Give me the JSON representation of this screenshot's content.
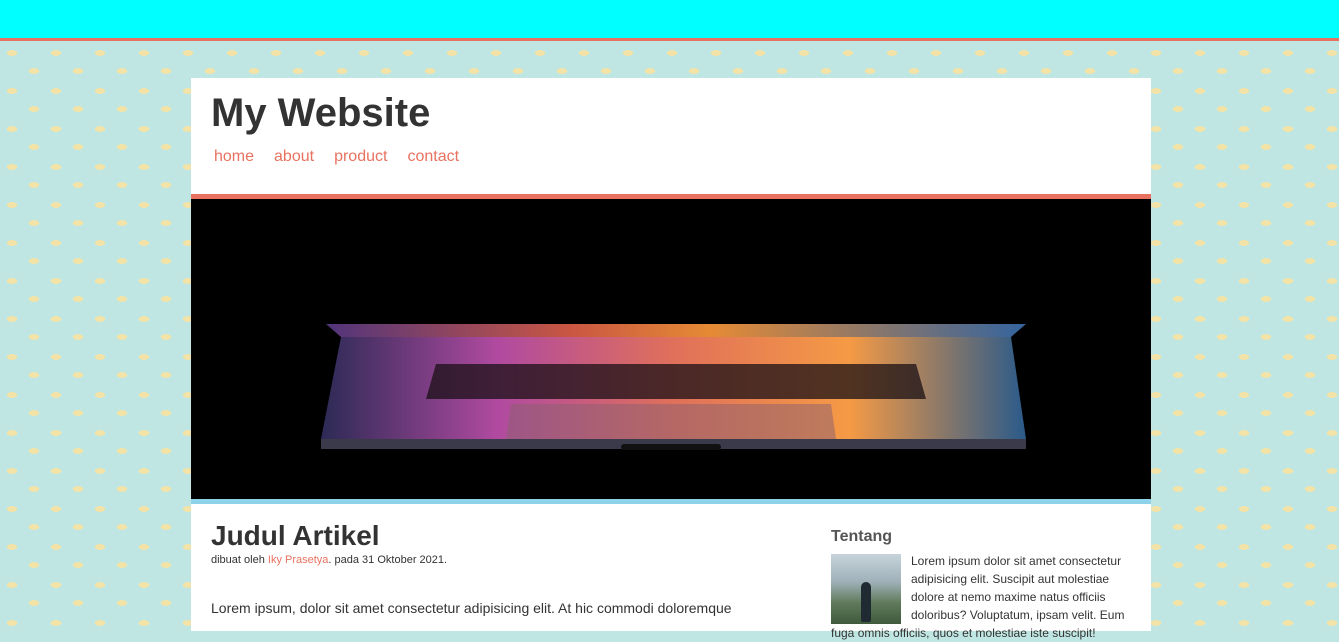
{
  "site": {
    "title": "My Website"
  },
  "nav": [
    {
      "label": "home"
    },
    {
      "label": "about"
    },
    {
      "label": "product"
    },
    {
      "label": "contact"
    }
  ],
  "article": {
    "title": "Judul Artikel",
    "byline_prefix": "dibuat oleh ",
    "author": "Iky Prasetya",
    "byline_suffix": ". pada 31 Oktober 2021.",
    "body": "Lorem ipsum, dolor sit amet consectetur adipisicing elit. At hic commodi doloremque"
  },
  "sidebar": {
    "heading": "Tentang",
    "text": "Lorem ipsum dolor sit amet consectetur adipisicing elit. Suscipit aut molestiae dolore at nemo maxime natus officiis doloribus? Voluptatum, ipsam velit. Eum fuga omnis officiis, quos et molestiae iste suscipit!"
  },
  "colors": {
    "accent": "#e8725f",
    "topbar": "#00ffff",
    "page_bg": "#bfe6e2"
  }
}
